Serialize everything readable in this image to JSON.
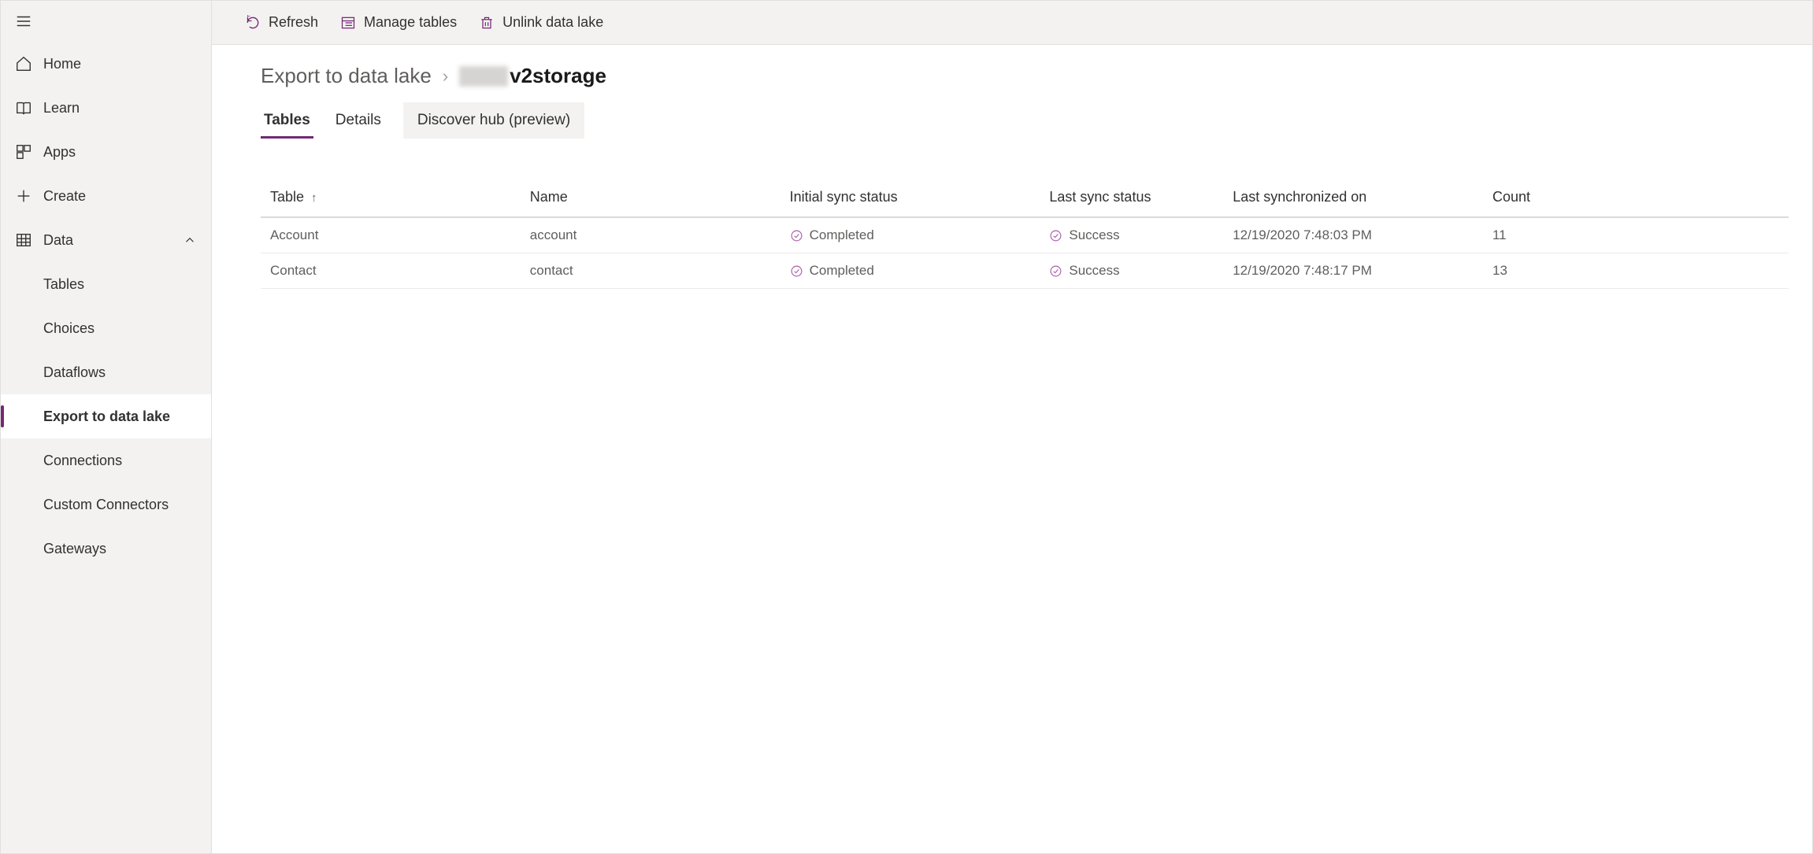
{
  "sidebar": {
    "items": [
      {
        "label": "Home"
      },
      {
        "label": "Learn"
      },
      {
        "label": "Apps"
      },
      {
        "label": "Create"
      },
      {
        "label": "Data"
      }
    ],
    "data_children": [
      {
        "label": "Tables"
      },
      {
        "label": "Choices"
      },
      {
        "label": "Dataflows"
      },
      {
        "label": "Export to data lake"
      },
      {
        "label": "Connections"
      },
      {
        "label": "Custom Connectors"
      },
      {
        "label": "Gateways"
      }
    ]
  },
  "toolbar": {
    "refresh": "Refresh",
    "manage": "Manage tables",
    "unlink": "Unlink data lake"
  },
  "breadcrumb": {
    "parent": "Export to data lake",
    "current_suffix": "v2storage"
  },
  "tabs": [
    {
      "label": "Tables"
    },
    {
      "label": "Details"
    },
    {
      "label": "Discover hub (preview)"
    }
  ],
  "table": {
    "headers": {
      "table": "Table",
      "name": "Name",
      "initial": "Initial sync status",
      "last": "Last sync status",
      "synced": "Last synchronized on",
      "count": "Count"
    },
    "rows": [
      {
        "table": "Account",
        "name": "account",
        "initial": "Completed",
        "last": "Success",
        "synced": "12/19/2020 7:48:03 PM",
        "count": "11"
      },
      {
        "table": "Contact",
        "name": "contact",
        "initial": "Completed",
        "last": "Success",
        "synced": "12/19/2020 7:48:17 PM",
        "count": "13"
      }
    ]
  }
}
